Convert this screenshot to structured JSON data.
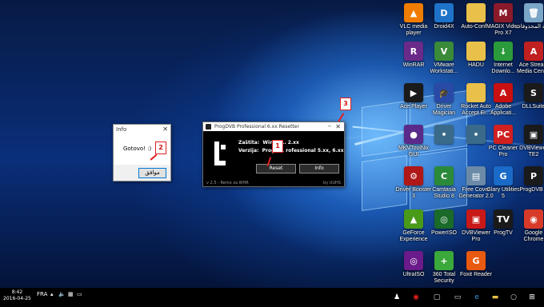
{
  "desktop": {
    "icons": [
      {
        "label": "VLC media player",
        "icon": "vlc-icon",
        "color": "#f07c00",
        "glyph": "▲"
      },
      {
        "label": "Droid4X",
        "icon": "droid4x-icon",
        "color": "#1e73c8",
        "glyph": "D"
      },
      {
        "label": "Auto-Conf...",
        "icon": "folder-icon",
        "color": "#e8c04a",
        "glyph": ""
      },
      {
        "label": "MAGIX Video Pro X7",
        "icon": "magix-icon",
        "color": "#8a1a2a",
        "glyph": "M"
      },
      {
        "label": "سلة المحذوفات",
        "icon": "recycle-bin-icon",
        "color": "#7aa6c8",
        "glyph": "🗑"
      },
      {
        "label": "WinRAR",
        "icon": "winrar-icon",
        "color": "#6a2a8a",
        "glyph": "R"
      },
      {
        "label": "VMware Workstati...",
        "icon": "vmware-icon",
        "color": "#3a8a3a",
        "glyph": "V"
      },
      {
        "label": "HADU",
        "icon": "folder-icon",
        "color": "#e8c04a",
        "glyph": ""
      },
      {
        "label": "Internet Downlo...",
        "icon": "idm-icon",
        "color": "#2a9a3a",
        "glyph": "↓"
      },
      {
        "label": "Ace Stream Media Center",
        "icon": "acestream-icon",
        "color": "#c02020",
        "glyph": "A"
      },
      {
        "label": "Ace Player",
        "icon": "aceplayer-icon",
        "color": "#1a1a1a",
        "glyph": "▶"
      },
      {
        "label": "Driver Magician",
        "icon": "driver-magician-icon",
        "color": "#2a4aa8",
        "glyph": "🎓"
      },
      {
        "label": "Rocket Auto Accept Ei...",
        "icon": "folder-icon",
        "color": "#e8c04a",
        "glyph": ""
      },
      {
        "label": "Adobe Applicati...",
        "icon": "adobe-icon",
        "color": "#c81010",
        "glyph": "A"
      },
      {
        "label": "DLLSuite",
        "icon": "dllsuite-icon",
        "color": "#1a1a1a",
        "glyph": "S"
      },
      {
        "label": "MKVToolNix GUI",
        "icon": "mkvtoolnix-icon",
        "color": "#5a2a8a",
        "glyph": "●"
      },
      {
        "label": "",
        "icon": "program-icon",
        "color": "#3a6a8a",
        "glyph": "•"
      },
      {
        "label": "",
        "icon": "program-icon",
        "color": "#3a6a8a",
        "glyph": "•"
      },
      {
        "label": "PC Cleaner Pro",
        "icon": "pc-cleaner-icon",
        "color": "#d02020",
        "glyph": "PC"
      },
      {
        "label": "DVBViewer TE2",
        "icon": "dvbviewer-icon",
        "color": "#1a1a1a",
        "glyph": "▣"
      },
      {
        "label": "Driver Booster 3",
        "icon": "driver-booster-icon",
        "color": "#b01818",
        "glyph": "⚙"
      },
      {
        "label": "Camtasia Studio 8",
        "icon": "camtasia-icon",
        "color": "#2a8a3a",
        "glyph": "C"
      },
      {
        "label": "Free Cover Generator 2.0",
        "icon": "cover-generator-icon",
        "color": "#6a8aa8",
        "glyph": "▤"
      },
      {
        "label": "Glary Utilities 5",
        "icon": "glary-icon",
        "color": "#1a6ac8",
        "glyph": "G"
      },
      {
        "label": "ProgDVB 7",
        "icon": "progdvb-icon",
        "color": "#1a1a1a",
        "glyph": "P"
      },
      {
        "label": "GeForce Experience",
        "icon": "geforce-icon",
        "color": "#4a9a1a",
        "glyph": "▲"
      },
      {
        "label": "PowerISO",
        "icon": "poweriso-icon",
        "color": "#1a6a2a",
        "glyph": "◎"
      },
      {
        "label": "DVBViewer Pro",
        "icon": "dvbviewer-icon",
        "color": "#c81818",
        "glyph": "▣"
      },
      {
        "label": "ProgTV",
        "icon": "progtv-icon",
        "color": "#1a1a1a",
        "glyph": "TV"
      },
      {
        "label": "Google Chrome",
        "icon": "chrome-icon",
        "color": "#d83a2a",
        "glyph": "◉"
      },
      {
        "label": "UltraISO",
        "icon": "ultraiso-icon",
        "color": "#6a1a8a",
        "glyph": "◎"
      },
      {
        "label": "360 Total Security",
        "icon": "360-security-icon",
        "color": "#3aa83a",
        "glyph": "+"
      },
      {
        "label": "Foxit Reader",
        "icon": "foxit-icon",
        "color": "#e85a10",
        "glyph": "G"
      }
    ]
  },
  "info_dialog": {
    "title": "Info",
    "message": "Gotovo! :)",
    "ok_label": "موافق"
  },
  "progdvb": {
    "title": "ProgDVB Professional 6.xx Resetter",
    "line1_label": "Zaštita:",
    "line1_value": "WinLic... 2.xx",
    "line2_label": "Verzija:",
    "line2_value": "ProgD... rofessional 5.xx, 6.xx",
    "reset_label": "Reset",
    "info_label": "Info",
    "footer_left": "v 2.5 - Remo za WHR",
    "footer_right": "by UUHS"
  },
  "annotations": {
    "step1": "1",
    "step2": "2",
    "step3": "3",
    "color": "#e02020"
  },
  "taskbar": {
    "time": "8:42",
    "date": "2016-04-25",
    "language": "FRA"
  }
}
